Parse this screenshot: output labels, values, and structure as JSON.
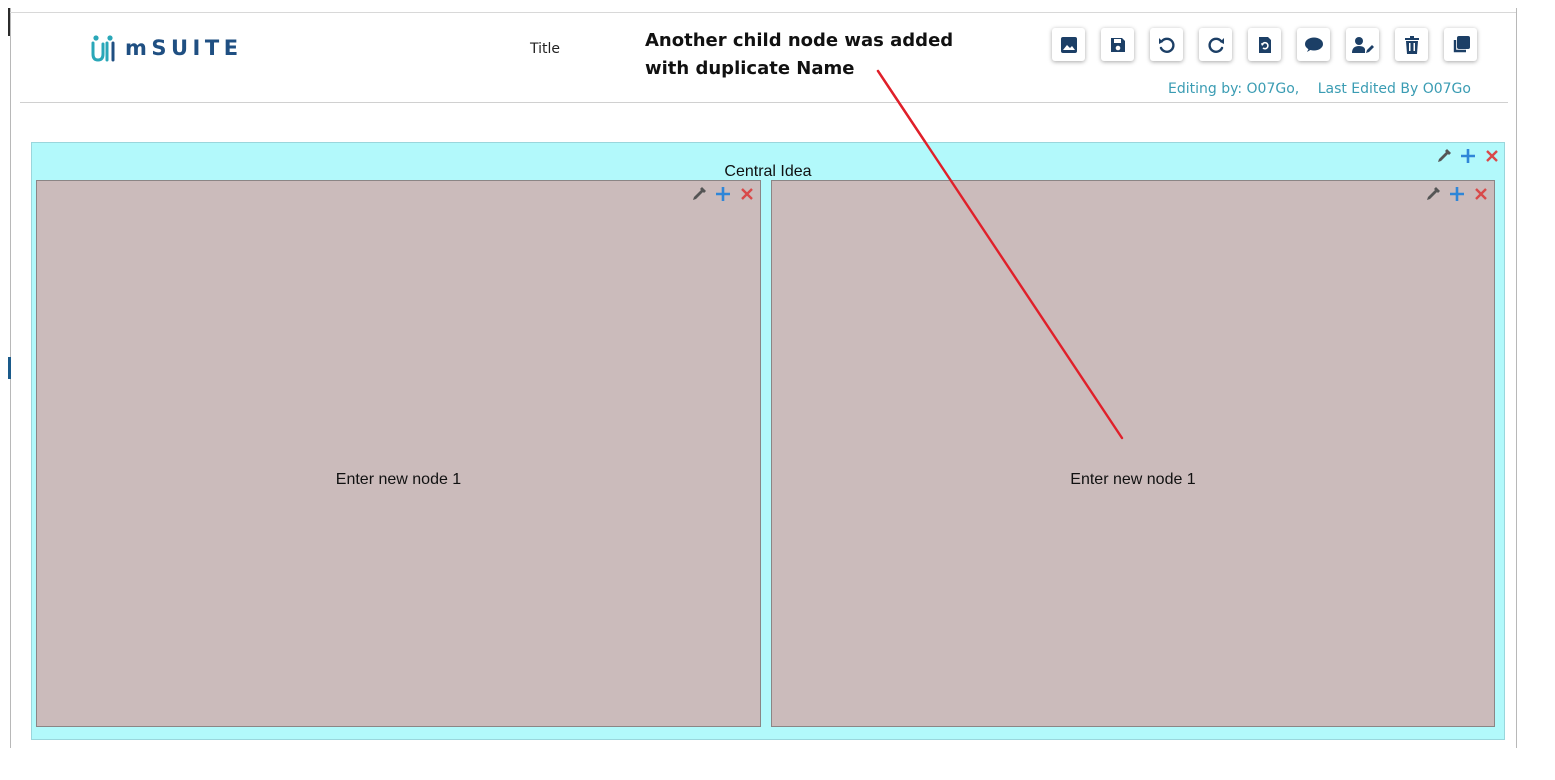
{
  "app": {
    "logo_text": "mSUITE",
    "title_label": "Title"
  },
  "annotation": {
    "lines": [
      "Another child node was added",
      "with duplicate Name"
    ],
    "arrow_color": "#e0202a"
  },
  "toolbar": {
    "buttons": [
      {
        "icon": "image-icon",
        "label": "Insert image"
      },
      {
        "icon": "save-icon",
        "label": "Save"
      },
      {
        "icon": "undo-icon",
        "label": "Undo"
      },
      {
        "icon": "redo-icon",
        "label": "Redo"
      },
      {
        "icon": "restore-file-icon",
        "label": "Restore"
      },
      {
        "icon": "comment-icon",
        "label": "Comments"
      },
      {
        "icon": "user-edit-icon",
        "label": "Editors"
      },
      {
        "icon": "trash-icon",
        "label": "Delete"
      },
      {
        "icon": "copy-icon",
        "label": "Copy"
      }
    ],
    "icon_color": "#1c3f66"
  },
  "editing": {
    "editing_by": "Editing by: O07Go,",
    "last_edited": "Last Edited By O07Go"
  },
  "mindmap": {
    "central": {
      "label": "Central Idea",
      "color": "#b2f9fb"
    },
    "children": [
      {
        "label": "Enter new node 1",
        "color": "#cbbbbb"
      },
      {
        "label": "Enter new node 1",
        "color": "#cbbbbb"
      }
    ],
    "action_icons": [
      "eyedropper-icon",
      "plus-icon",
      "close-icon"
    ],
    "action_colors": {
      "eyedropper": "#555555",
      "plus": "#2f86d8",
      "close": "#d94a4a"
    }
  }
}
